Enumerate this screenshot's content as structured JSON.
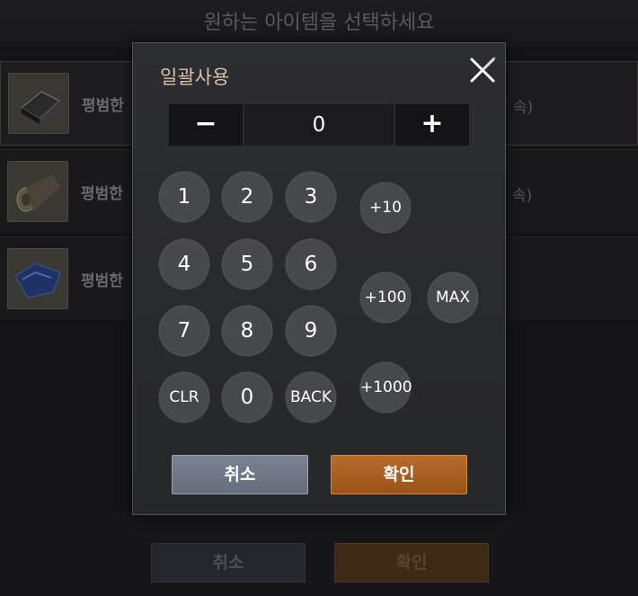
{
  "background": {
    "title": "원하는 아이템을 선택하세요",
    "items": [
      {
        "name": "평범한",
        "note": "속)",
        "icon": "bar-icon"
      },
      {
        "name": "평범한",
        "note": "속)",
        "icon": "log-icon"
      },
      {
        "name": "평범한",
        "note": "",
        "icon": "cloth-icon"
      }
    ],
    "cancel_label": "취소",
    "confirm_label": "확인"
  },
  "dialog": {
    "title": "일괄사용",
    "close_icon": "close-icon",
    "minus_label": "−",
    "plus_label": "+",
    "quantity": "0",
    "keys": {
      "k1": "1",
      "k2": "2",
      "k3": "3",
      "k4": "4",
      "k5": "5",
      "k6": "6",
      "k7": "7",
      "k8": "8",
      "k9": "9",
      "clr": "CLR",
      "k0": "0",
      "back": "BACK",
      "p10": "+10",
      "p100": "+100",
      "p1000": "+1000",
      "max": "MAX"
    },
    "cancel_label": "취소",
    "confirm_label": "확인"
  },
  "colors": {
    "title_accent": "#d9c2a3",
    "confirm": "#b66b2a",
    "cancel": "#7b8292"
  }
}
